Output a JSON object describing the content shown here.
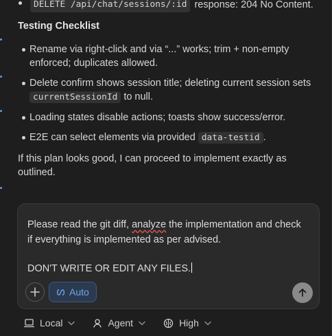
{
  "top": {
    "code": "DELETE /api/chat/sessions/:id",
    "text": "response: 204 No Content."
  },
  "section_heading": "Testing Checklist",
  "checklist": {
    "i1": {
      "text": "Rename via right-click and via “...” works; trim + non-empty enforced; duplicates allowed."
    },
    "i2": {
      "pre": "Delete confirm shows session title; deleting current session sets",
      "code": "currentSessionId",
      "post": "to null."
    },
    "i3": {
      "text": "Loading states disable actions; toasts show success/error."
    },
    "i4": {
      "pre": "E2E can select elements via provided",
      "code": "data-testid",
      "post": "."
    }
  },
  "closing_paragraph": "If this plan looks good, I can proceed to implement exactly as outlined.",
  "composer": {
    "line1_pre": "Please read the git diff,",
    "line1_misspelled": "analyze",
    "line1_post": "the implementation and check if everything is implemented as per advised.",
    "line2": "DON'T WRITE OR EDIT ANY FILES.",
    "plus_icon": "plus-icon",
    "auto_label": "Auto",
    "auto_icon": "infinity-icon",
    "send_icon": "arrow-up-icon"
  },
  "bottom_bar": {
    "local_label": "Local",
    "agent_label": "Agent",
    "high_label": "High"
  },
  "colors": {
    "background": "#1e1e1e",
    "accent": "#6fa8ef",
    "composer_bg": "#2a2a2a"
  }
}
